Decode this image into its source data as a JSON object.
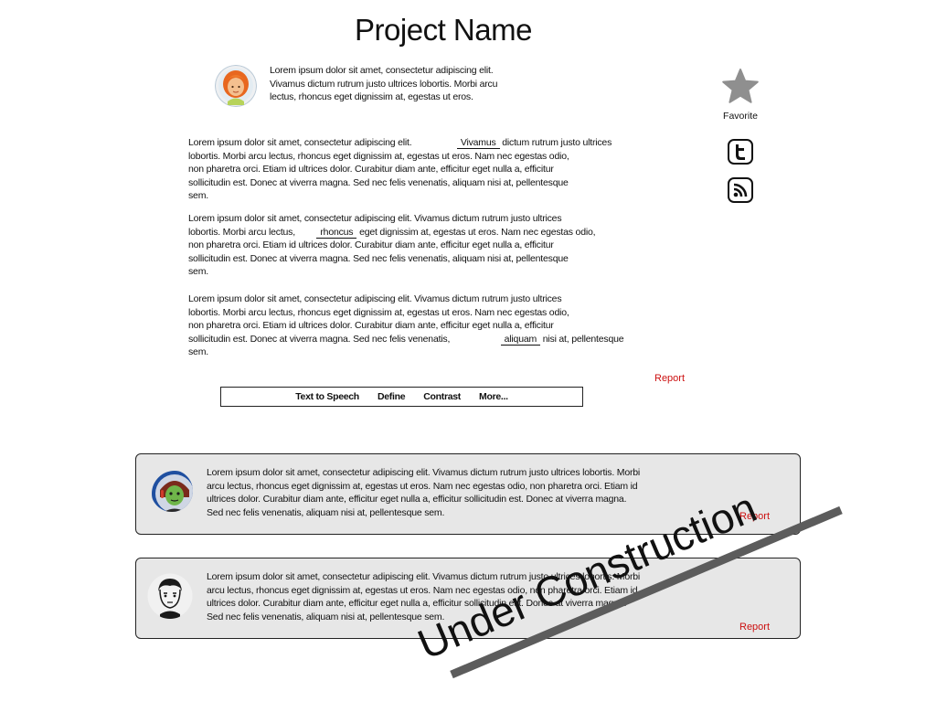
{
  "header": {
    "title": "Project Name"
  },
  "intro": {
    "lines": [
      "Lorem ipsum dolor sit amet, consectetur adipiscing elit.",
      "Vivamus dictum rutrum justo ultrices lobortis. Morbi arcu",
      "lectus, rhoncus eget dignissim at, egestas ut eros."
    ]
  },
  "article": {
    "p1": {
      "l1a": "Lorem ipsum dolor sit amet, consectetur adipiscing elit.",
      "l1link": "Vivamus",
      "l1b": "dictum rutrum justo ultrices",
      "l2": "lobortis. Morbi arcu lectus, rhoncus eget dignissim at, egestas ut eros. Nam nec egestas odio,",
      "l3": "non pharetra orci. Etiam id ultrices dolor. Curabitur diam ante, efficitur eget nulla a, efficitur",
      "l4": "sollicitudin est. Donec at viverra magna. Sed nec felis venenatis, aliquam nisi at, pellentesque",
      "l5": "sem."
    },
    "p2": {
      "l1": "Lorem ipsum dolor sit amet, consectetur adipiscing elit. Vivamus dictum rutrum justo ultrices",
      "l2a": "lobortis. Morbi arcu lectus,",
      "l2link": "rhoncus",
      "l2b": "eget dignissim at, egestas ut eros. Nam nec egestas odio,",
      "l3": "non pharetra orci. Etiam id ultrices dolor. Curabitur diam ante, efficitur eget nulla a, efficitur",
      "l4": "sollicitudin est. Donec at viverra magna. Sed nec felis venenatis, aliquam nisi at, pellentesque",
      "l5": "sem."
    },
    "p3": {
      "l1": "Lorem ipsum dolor sit amet, consectetur adipiscing elit. Vivamus dictum rutrum justo ultrices",
      "l2": "lobortis. Morbi arcu lectus, rhoncus eget dignissim at, egestas ut eros. Nam nec egestas odio,",
      "l3": "non pharetra orci. Etiam id ultrices dolor. Curabitur diam ante, efficitur eget nulla a, efficitur",
      "l4a": "sollicitudin est. Donec at viverra magna. Sed nec felis venenatis,",
      "l4link": "aliquam",
      "l4b": "nisi at, pellentesque",
      "l5": "sem."
    },
    "report": "Report"
  },
  "sidebar": {
    "favorite_label": "Favorite",
    "favorite_icon": "star-icon",
    "twitter_icon": "twitter-icon",
    "rss_icon": "rss-icon"
  },
  "toolbar": {
    "tts": "Text to Speech",
    "define": "Define",
    "contrast": "Contrast",
    "more": "More..."
  },
  "comments": [
    {
      "lines": [
        "Lorem ipsum dolor sit amet, consectetur adipiscing elit. Vivamus dictum rutrum justo ultrices lobortis. Morbi",
        " arcu lectus, rhoncus eget dignissim at, egestas ut eros. Nam nec egestas odio, non pharetra orci. Etiam id",
        " ultrices dolor. Curabitur diam ante, efficitur eget nulla a, efficitur sollicitudin est. Donec at viverra magna.",
        "Sed nec felis venenatis, aliquam nisi at, pellentesque sem."
      ],
      "report": "Report"
    },
    {
      "lines": [
        "Lorem ipsum dolor sit amet, consectetur adipiscing elit. Vivamus dictum rutrum justo ultrices lobortis. Morbi",
        " arcu lectus, rhoncus eget dignissim at, egestas ut eros. Nam nec egestas odio, non pharetra orci. Etiam id",
        " ultrices dolor. Curabitur diam ante, efficitur eget nulla a, efficitur sollicitudin est. Donec at viverra magna.",
        "Sed nec felis venenatis, aliquam nisi at, pellentesque sem."
      ],
      "report": "Report"
    }
  ],
  "overlay": {
    "stamp_text": "Under Construction",
    "stamp_color": "#111111",
    "bar_color": "#5c5c5c"
  },
  "colors": {
    "report": "#cc1010",
    "comment_bg": "#e7e7e7"
  }
}
